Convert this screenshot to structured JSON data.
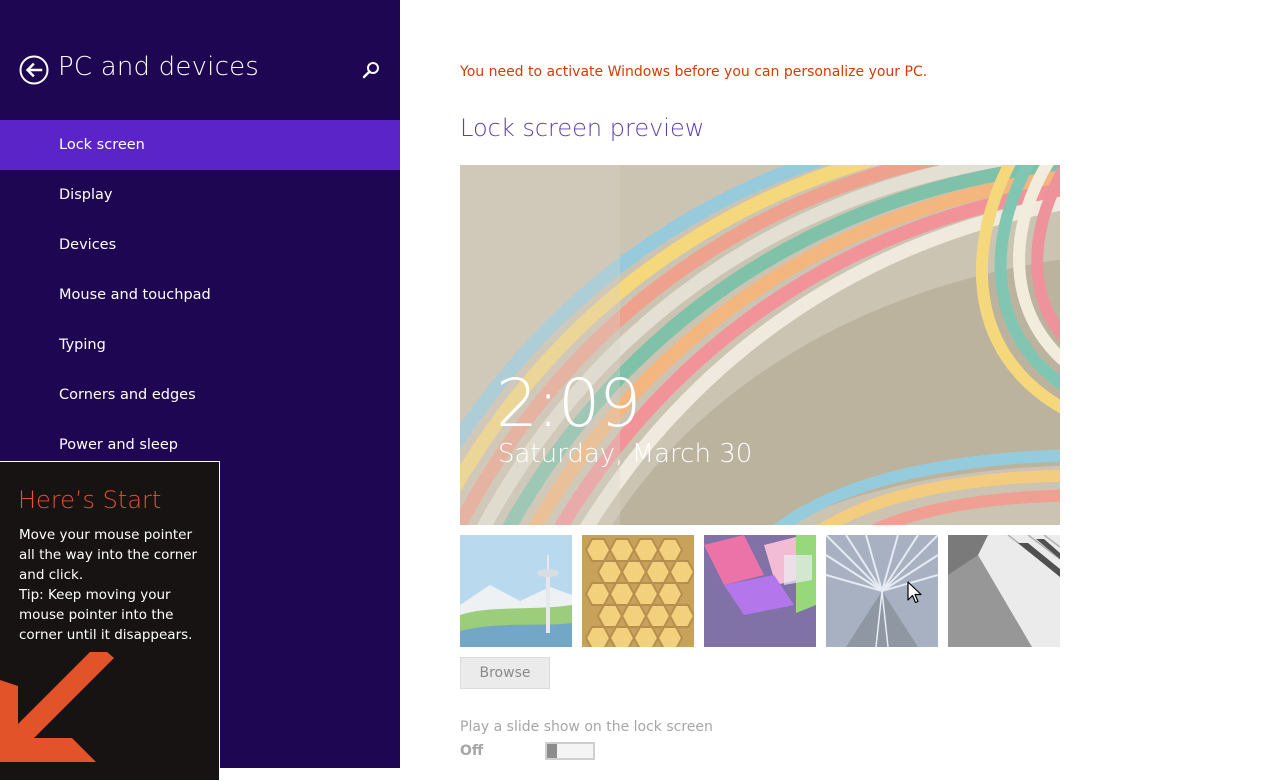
{
  "sidebar": {
    "title": "PC and devices",
    "back_icon": "back-arrow-icon",
    "search_icon": "search-icon",
    "items": [
      {
        "label": "Lock screen",
        "active": true
      },
      {
        "label": "Display",
        "active": false
      },
      {
        "label": "Devices",
        "active": false
      },
      {
        "label": "Mouse and touchpad",
        "active": false
      },
      {
        "label": "Typing",
        "active": false
      },
      {
        "label": "Corners and edges",
        "active": false
      },
      {
        "label": "Power and sleep",
        "active": false
      }
    ]
  },
  "tip": {
    "title": "Here’s Start",
    "lines": [
      "Move your mouse pointer",
      "all the way into the corner",
      "and click.",
      "Tip: Keep moving your",
      "mouse pointer into the",
      "corner until it disappears."
    ],
    "arrow_icon": "corner-arrow-icon"
  },
  "main": {
    "activation_message": "You need to activate Windows before you can personalize your PC.",
    "preview_heading": "Lock screen preview",
    "preview": {
      "time": "2:09",
      "date": "Saturday, March 30"
    },
    "thumbnails": [
      "space-needle",
      "honeycomb",
      "geometric-shapes",
      "tunnel",
      "piano-keys"
    ],
    "browse_label": "Browse",
    "slideshow_label": "Play a slide show on the lock screen",
    "slideshow_state": "Off",
    "slideshow_on": false
  },
  "colors": {
    "sidebar_bg": "#1f0652",
    "sidebar_active": "#5b24c9",
    "accent_heading": "#5b3fb5",
    "warning": "#d83b01",
    "tip_title": "#e8522a"
  }
}
